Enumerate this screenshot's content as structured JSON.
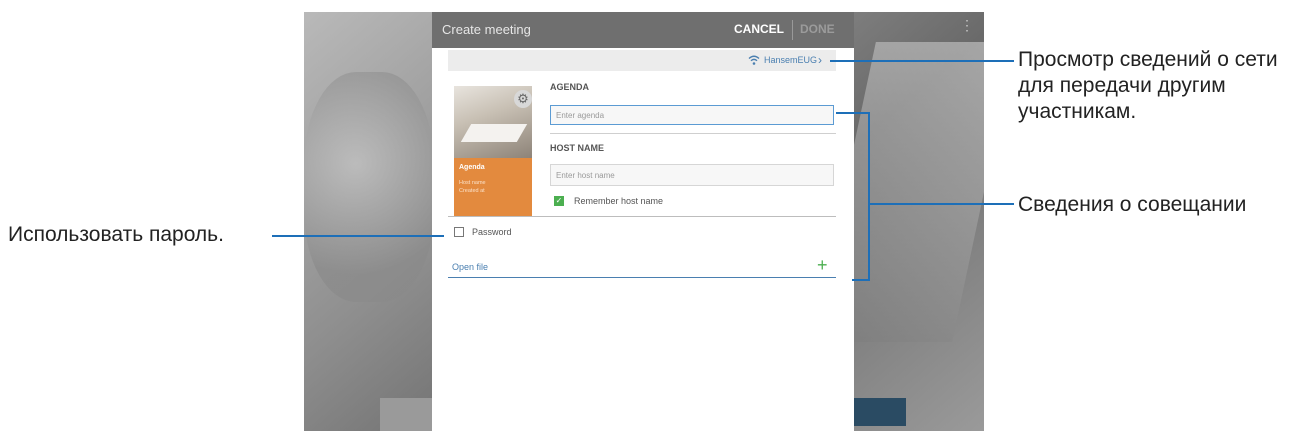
{
  "dialog": {
    "title": "Create meeting",
    "cancel_label": "CANCEL",
    "done_label": "DONE",
    "more_icon": "more-vertical-icon"
  },
  "network": {
    "name": "HansemEUG",
    "icon": "wifi-icon",
    "chevron": "chevron-right-icon"
  },
  "thumbnail": {
    "title": "Agenda",
    "line1": "Host name",
    "line2": "Created at",
    "accent": "#e38a3e"
  },
  "form": {
    "agenda_label": "AGENDA",
    "agenda_placeholder": "Enter agenda",
    "host_label": "HOST NAME",
    "host_placeholder": "Enter host name",
    "remember_label": "Remember host name",
    "remember_checked": true,
    "password_label": "Password",
    "password_checked": false,
    "open_file_label": "Open file"
  },
  "callouts": {
    "network_info": "Просмотр сведений о сети для передачи другим участникам.",
    "meeting_info": "Сведения о совещании",
    "use_password": "Использовать пароль."
  },
  "colors": {
    "callout_line": "#1d6fb8",
    "accent_blue": "#4a7fb0",
    "check_green": "#4caf50"
  }
}
